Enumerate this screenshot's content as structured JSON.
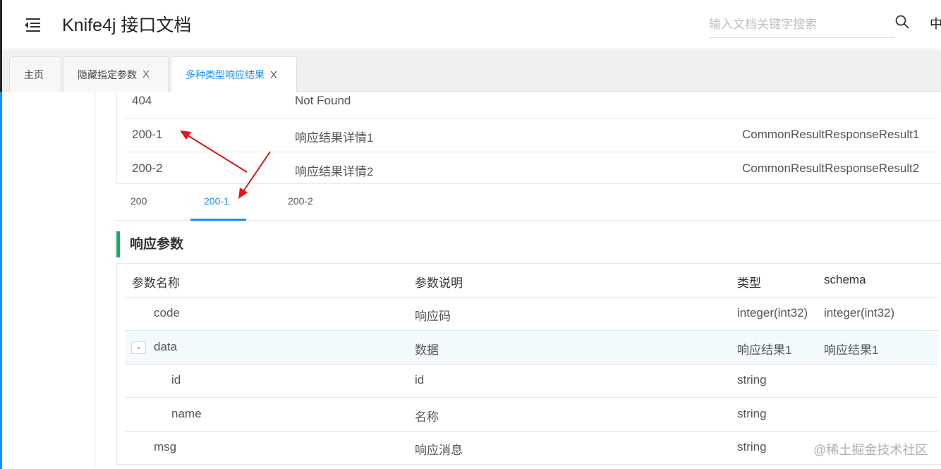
{
  "header": {
    "title": "Knife4j 接口文档",
    "search_placeholder": "输入文档关键字搜索",
    "lang": "中"
  },
  "tabs": [
    {
      "label": "主页",
      "closable": false
    },
    {
      "label": "隐藏指定参数",
      "closable": true
    },
    {
      "label": "多种类型响应结果",
      "closable": true,
      "active": true
    }
  ],
  "tab_close": "X",
  "status_rows": [
    {
      "code": "404",
      "desc": "Not Found",
      "schema": ""
    },
    {
      "code": "200-1",
      "desc": "响应结果详情1",
      "schema": "CommonResultResponseResult1"
    },
    {
      "code": "200-2",
      "desc": "响应结果详情2",
      "schema": "CommonResultResponseResult2"
    }
  ],
  "response_tabs": [
    "200",
    "200-1",
    "200-2"
  ],
  "active_response_tab": "200-1",
  "section_title": "响应参数",
  "params": {
    "headers": [
      "参数名称",
      "参数说明",
      "类型",
      "schema"
    ],
    "rows": [
      {
        "name": "code",
        "desc": "响应码",
        "type": "integer(int32)",
        "schema": "integer(int32)"
      },
      {
        "name": "data",
        "desc": "数据",
        "type": "响应结果1",
        "schema": "响应结果1",
        "toggle": "-"
      },
      {
        "name": "id",
        "desc": "id",
        "type": "string",
        "schema": ""
      },
      {
        "name": "name",
        "desc": "名称",
        "type": "string",
        "schema": ""
      },
      {
        "name": "msg",
        "desc": "响应消息",
        "type": "string",
        "schema": ""
      }
    ]
  },
  "watermark": "@稀土掘金技术社区",
  "colors": {
    "accent": "#1890ff",
    "section_bar": "#1aab65",
    "annotation_arrow": "#e8141b"
  }
}
